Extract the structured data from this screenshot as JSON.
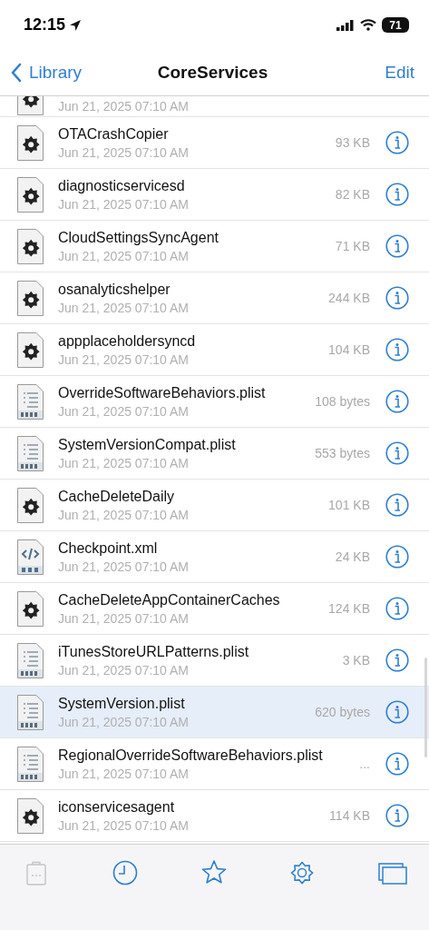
{
  "status_bar": {
    "time": "12:15",
    "battery": "71"
  },
  "nav": {
    "back": "Library",
    "title": "CoreServices",
    "action": "Edit"
  },
  "partial_row": {
    "kind": "exec",
    "date": "Jun 21, 2025 07:10 AM"
  },
  "files": [
    {
      "name": "OTACrashCopier",
      "date": "Jun 21, 2025 07:10 AM",
      "size": "93 KB",
      "kind": "exec",
      "selected": false
    },
    {
      "name": "diagnosticservicesd",
      "date": "Jun 21, 2025 07:10 AM",
      "size": "82 KB",
      "kind": "exec",
      "selected": false
    },
    {
      "name": "CloudSettingsSyncAgent",
      "date": "Jun 21, 2025 07:10 AM",
      "size": "71 KB",
      "kind": "exec",
      "selected": false
    },
    {
      "name": "osanalyticshelper",
      "date": "Jun 21, 2025 07:10 AM",
      "size": "244 KB",
      "kind": "exec",
      "selected": false
    },
    {
      "name": "appplaceholdersyncd",
      "date": "Jun 21, 2025 07:10 AM",
      "size": "104 KB",
      "kind": "exec",
      "selected": false
    },
    {
      "name": "OverrideSoftwareBehaviors.plist",
      "date": "Jun 21, 2025 07:10 AM",
      "size": "108 bytes",
      "kind": "plist",
      "selected": false
    },
    {
      "name": "SystemVersionCompat.plist",
      "date": "Jun 21, 2025 07:10 AM",
      "size": "553 bytes",
      "kind": "plist",
      "selected": false
    },
    {
      "name": "CacheDeleteDaily",
      "date": "Jun 21, 2025 07:10 AM",
      "size": "101 KB",
      "kind": "exec",
      "selected": false
    },
    {
      "name": "Checkpoint.xml",
      "date": "Jun 21, 2025 07:10 AM",
      "size": "24 KB",
      "kind": "xml",
      "selected": false
    },
    {
      "name": "CacheDeleteAppContainerCaches",
      "date": "Jun 21, 2025 07:10 AM",
      "size": "124 KB",
      "kind": "exec",
      "selected": false
    },
    {
      "name": "iTunesStoreURLPatterns.plist",
      "date": "Jun 21, 2025 07:10 AM",
      "size": "3 KB",
      "kind": "plist",
      "selected": false
    },
    {
      "name": "SystemVersion.plist",
      "date": "Jun 21, 2025 07:10 AM",
      "size": "620 bytes",
      "kind": "plist",
      "selected": true
    },
    {
      "name": "RegionalOverrideSoftwareBehaviors.plist",
      "date": "Jun 21, 2025 07:10 AM",
      "size": "...",
      "kind": "plist",
      "selected": false
    },
    {
      "name": "iconservicesagent",
      "date": "Jun 21, 2025 07:10 AM",
      "size": "114 KB",
      "kind": "exec",
      "selected": false
    }
  ],
  "toolbar": [
    {
      "kind": "clipboard",
      "disabled": true
    },
    {
      "kind": "clock",
      "disabled": false
    },
    {
      "kind": "star",
      "disabled": false
    },
    {
      "kind": "gear",
      "disabled": false
    },
    {
      "kind": "windows",
      "disabled": false
    }
  ]
}
